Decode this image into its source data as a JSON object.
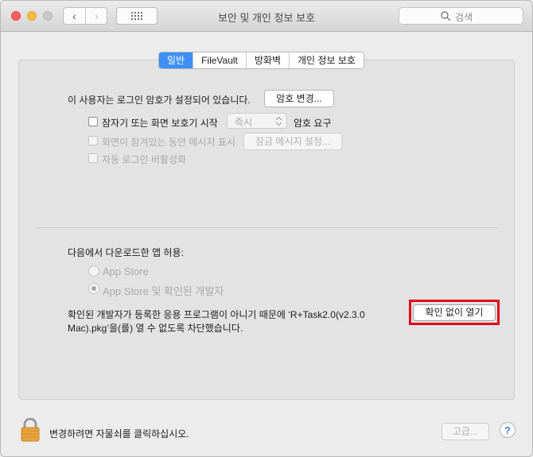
{
  "window": {
    "title": "보안 및 개인 정보 보호"
  },
  "search": {
    "placeholder": "검색"
  },
  "tabs": [
    {
      "label": "일반",
      "active": true
    },
    {
      "label": "FileVault",
      "active": false
    },
    {
      "label": "방화벽",
      "active": false
    },
    {
      "label": "개인 정보 보호",
      "active": false
    }
  ],
  "general": {
    "login_password_text": "이 사용자는 로그인 암호가 설정되어 있습니다.",
    "change_password_button": "암호 변경...",
    "require_password_label": "잠자기 또는 화면 보호기 시작",
    "require_password_delay": "즉시",
    "require_password_suffix": "암호 요구",
    "show_message_label": "화면이 잠겨있는 동안 메시지 표시",
    "set_lock_message_button": "잠금 메시지 설정...",
    "disable_auto_login_label": "자동 로그인 비활성화"
  },
  "downloads": {
    "heading": "다음에서 다운로드한 앱 허용:",
    "option_app_store": "App Store",
    "option_app_store_identified": "App Store 및 확인된 개발자",
    "selected_option": "App Store 및 확인된 개발자",
    "blocked_message_line1": "확인된 개발자가 등록한 응용 프로그램이 아니기 때문에 ‘R+Task2.0(v2.3.0",
    "blocked_message_line2": "Mac).pkg’을(를) 열 수 없도록 차단했습니다.",
    "open_anyway_button": "확인 없이 열기"
  },
  "footer": {
    "lock_text": "변경하려면 자물쇠를 클릭하십시오.",
    "advanced_button": "고급...",
    "help_button": "?"
  },
  "colors": {
    "accent": "#3d8ff6",
    "highlight_border": "#e3001b"
  }
}
